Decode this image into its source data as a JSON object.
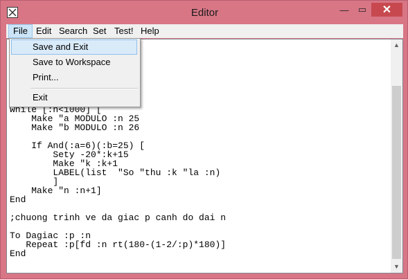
{
  "window": {
    "title": "Editor",
    "close_glyph": "✕",
    "min_glyph": "—",
    "max_glyph": "▭"
  },
  "menubar": {
    "items": [
      "File",
      "Edit",
      "Search",
      "Set",
      "Test!",
      "Help"
    ]
  },
  "file_menu": {
    "items": [
      "Save and Exit",
      "Save to Workspace",
      "Print...",
      "Exit"
    ]
  },
  "editor": {
    "code": "\n\n\n\n\n\n\nwhile [:n<1000] [\n    Make \"a MODULO :n 25\n    Make \"b MODULO :n 26\n\n    If And(:a=6)(:b=25) [\n        Sety -20*:k+15\n        Make \"k :k+1\n        LABEL(list  \"So \"thu :k \"la :n)\n        ]\n    Make \"n :n+1]\nEnd\n\n;chuong trinh ve da giac p canh do dai n\n\nTo Dagiac :p :n\n   Repeat :p[fd :n rt(180-(1-2/:p)*180)]\nEnd"
  },
  "colors": {
    "title_bar": "#d87686",
    "close_button": "#c7494f",
    "menu_active": "#cce4f7"
  }
}
